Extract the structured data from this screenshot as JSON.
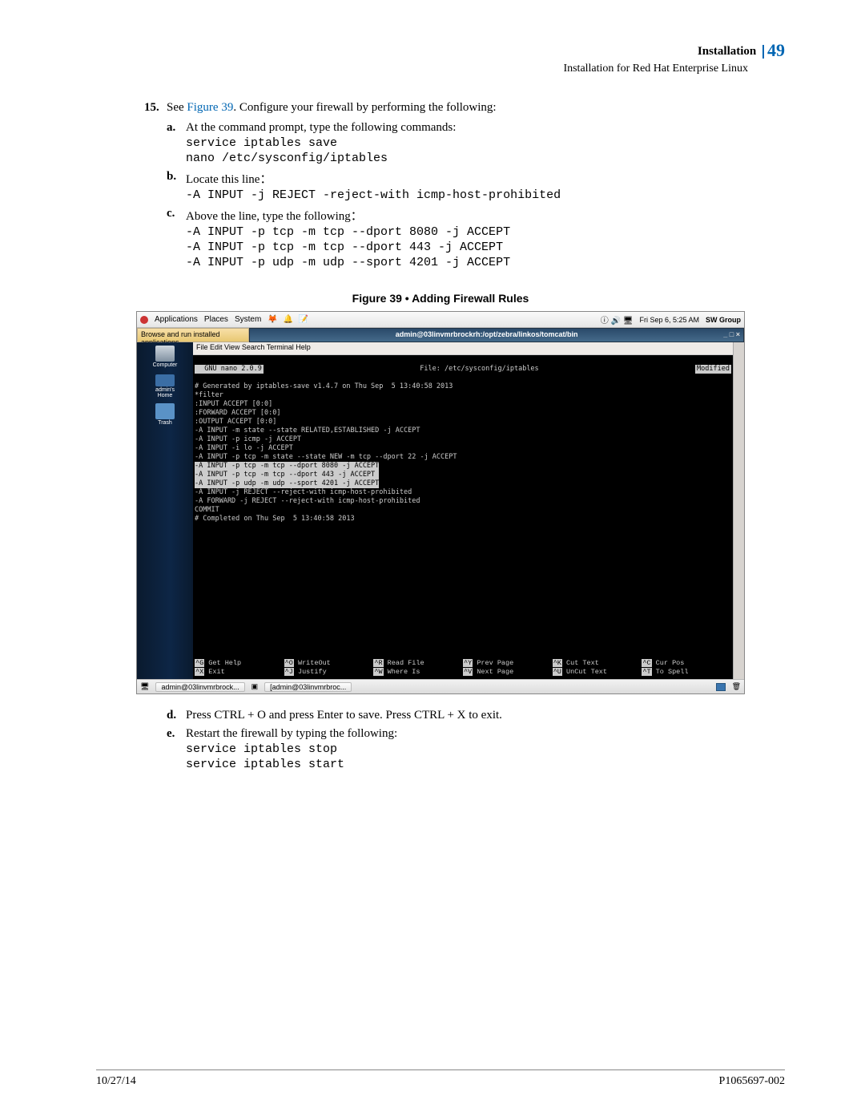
{
  "header": {
    "title": "Installation",
    "page": "49",
    "subtitle": "Installation for Red Hat Enterprise Linux"
  },
  "step": {
    "num": "15.",
    "text_a": "See ",
    "fig": "Figure 39",
    "text_b": ". Configure your firewall by performing the following:"
  },
  "a": {
    "let": "a.",
    "text": "At the command prompt, type the following commands:",
    "cmd1": "service iptables save",
    "cmd2": "nano /etc/sysconfig/iptables"
  },
  "b": {
    "let": "b.",
    "text": "Locate this line",
    "colon": "：",
    "cmd": "-A INPUT -j REJECT -reject-with icmp-host-prohibited"
  },
  "c": {
    "let": "c.",
    "text": "Above the line, type the following",
    "colon": "：",
    "cmd1": "-A INPUT -p tcp -m tcp --dport 8080 -j ACCEPT",
    "cmd2": "-A INPUT -p tcp -m tcp --dport 443 -j ACCEPT",
    "cmd3": "-A INPUT -p udp -m udp --sport 4201 -j ACCEPT"
  },
  "figcap": "Figure 39 • Adding Firewall Rules",
  "ss": {
    "menu": {
      "apps": "Applications",
      "places": "Places",
      "system": "System",
      "time": "Fri Sep 6, 5:25 AM",
      "sw": "SW Group"
    },
    "sub_l": "Browse and run installed applications",
    "sub_r": "admin@03linvmrbrockrh:/opt/zebra/linkos/tomcat/bin",
    "winctl": "_ □ ×",
    "desk": {
      "comp": "Computer",
      "home": "admin's Home",
      "trash": "Trash"
    },
    "tmenu": "File  Edit  View  Search  Terminal  Help",
    "nanov": "  GNU nano 2.0.9",
    "nanof": "File: /etc/sysconfig/iptables",
    "nanom": "Modified",
    "lines": "# Generated by iptables-save v1.4.7 on Thu Sep  5 13:40:58 2013\n*filter\n:INPUT ACCEPT [0:0]\n:FORWARD ACCEPT [0:0]\n:OUTPUT ACCEPT [0:0]\n-A INPUT -m state --state RELATED,ESTABLISHED -j ACCEPT\n-A INPUT -p icmp -j ACCEPT\n-A INPUT -i lo -j ACCEPT\n-A INPUT -p tcp -m state --state NEW -m tcp --dport 22 -j ACCEPT",
    "hl": "-A INPUT -p tcp -m tcp --dport 8080 -j ACCEPT\n-A INPUT -p tcp -m tcp --dport 443 -j ACCEPT\n-A INPUT -p udp -m udp --sport 4201 -j ACCEPT",
    "lines2": "-A INPUT -j REJECT --reject-with icmp-host-prohibited\n-A FORWARD -j REJECT --reject-with icmp-host-prohibited\nCOMMIT\n# Completed on Thu Sep  5 13:40:58 2013",
    "foot": {
      "g": "^G",
      "gt": " Get Help",
      "o": "^O",
      "ot": " WriteOut",
      "r": "^R",
      "rt": " Read File",
      "y": "^Y",
      "yt": " Prev Page",
      "k": "^K",
      "kt": " Cut Text",
      "c": "^C",
      "ct": " Cur Pos",
      "x": "^X",
      "xt": " Exit",
      "j": "^J",
      "jt": " Justify",
      "w": "^W",
      "wt": " Where Is",
      "v": "^V",
      "vt": " Next Page",
      "u": "^U",
      "ut": " UnCut Text",
      "t": "^T",
      "tt": " To Spell"
    },
    "tb1": "admin@03linvmrbrock...",
    "tb2": "[admin@03linvmrbroc..."
  },
  "d": {
    "let": "d.",
    "text": "Press CTRL + O and press Enter to save. Press CTRL + X to exit."
  },
  "e": {
    "let": "e.",
    "text": "Restart the firewall by typing the following:",
    "cmd1": "service iptables stop",
    "cmd2": "service iptables start"
  },
  "footer": {
    "date": "10/27/14",
    "doc": "P1065697-002"
  }
}
